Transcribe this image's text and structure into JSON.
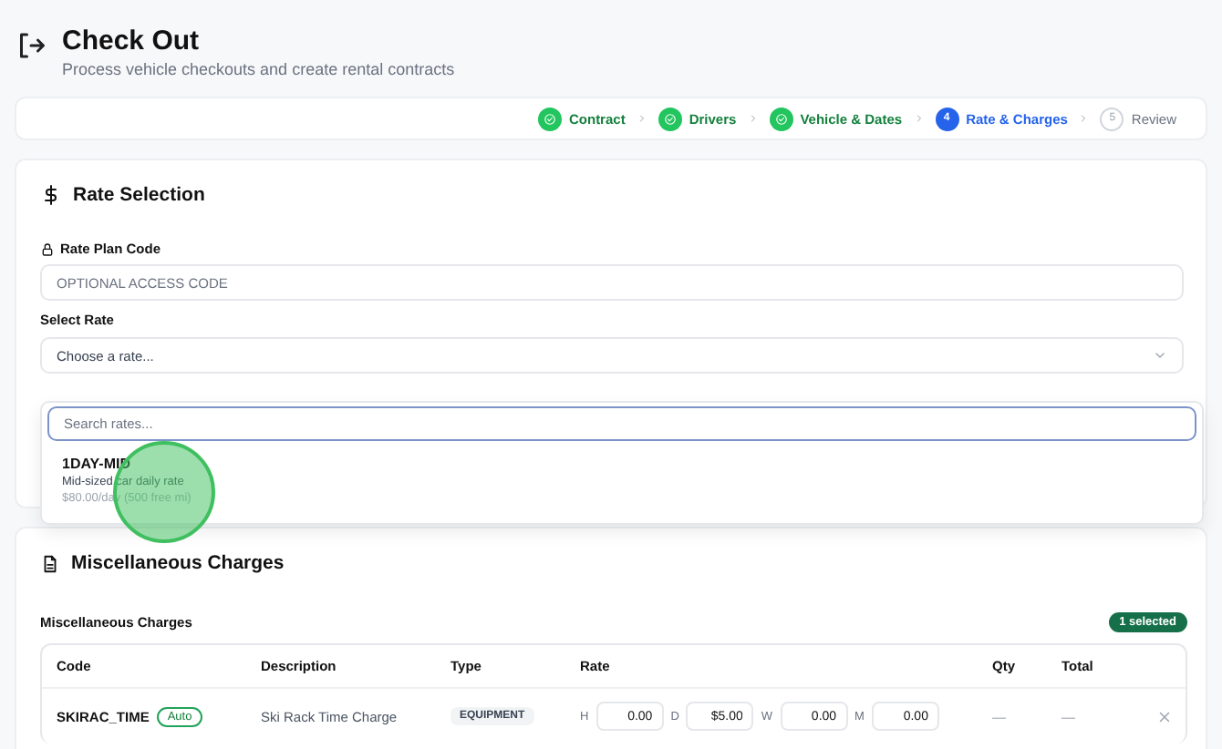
{
  "header": {
    "title": "Check Out",
    "subtitle": "Process vehicle checkouts and create rental contracts"
  },
  "steps": [
    {
      "label": "Contract",
      "kind": "done"
    },
    {
      "label": "Drivers",
      "kind": "done"
    },
    {
      "label": "Vehicle & Dates",
      "kind": "done"
    },
    {
      "label": "Rate & Charges",
      "kind": "current",
      "number": "4"
    },
    {
      "label": "Review",
      "kind": "pending",
      "number": "5"
    }
  ],
  "rate_selection": {
    "title": "Rate Selection",
    "plan_code_label": "Rate Plan Code",
    "plan_code_placeholder": "OPTIONAL ACCESS CODE",
    "select_label": "Select Rate",
    "select_placeholder": "Choose a rate...",
    "dropdown": {
      "search_placeholder": "Search rates...",
      "options": [
        {
          "code": "1DAY-MID",
          "description": "Mid-sized car daily rate",
          "price": "$80.00/day (500 free mi)"
        }
      ]
    }
  },
  "misc_charges": {
    "title": "Miscellaneous Charges",
    "subtitle": "Miscellaneous Charges",
    "badge": "1 selected",
    "columns": [
      "Code",
      "Description",
      "Type",
      "Rate",
      "Qty",
      "Total"
    ],
    "rows": [
      {
        "code": "SKIRAC_TIME",
        "tag": "Auto",
        "description": "Ski Rack Time Charge",
        "type": "EQUIPMENT",
        "rates": [
          {
            "unit": "H",
            "value": "0.00"
          },
          {
            "unit": "D",
            "value": "$5.00"
          },
          {
            "unit": "W",
            "value": "0.00"
          },
          {
            "unit": "M",
            "value": "0.00"
          }
        ],
        "qty": "—",
        "total": "—"
      }
    ]
  }
}
